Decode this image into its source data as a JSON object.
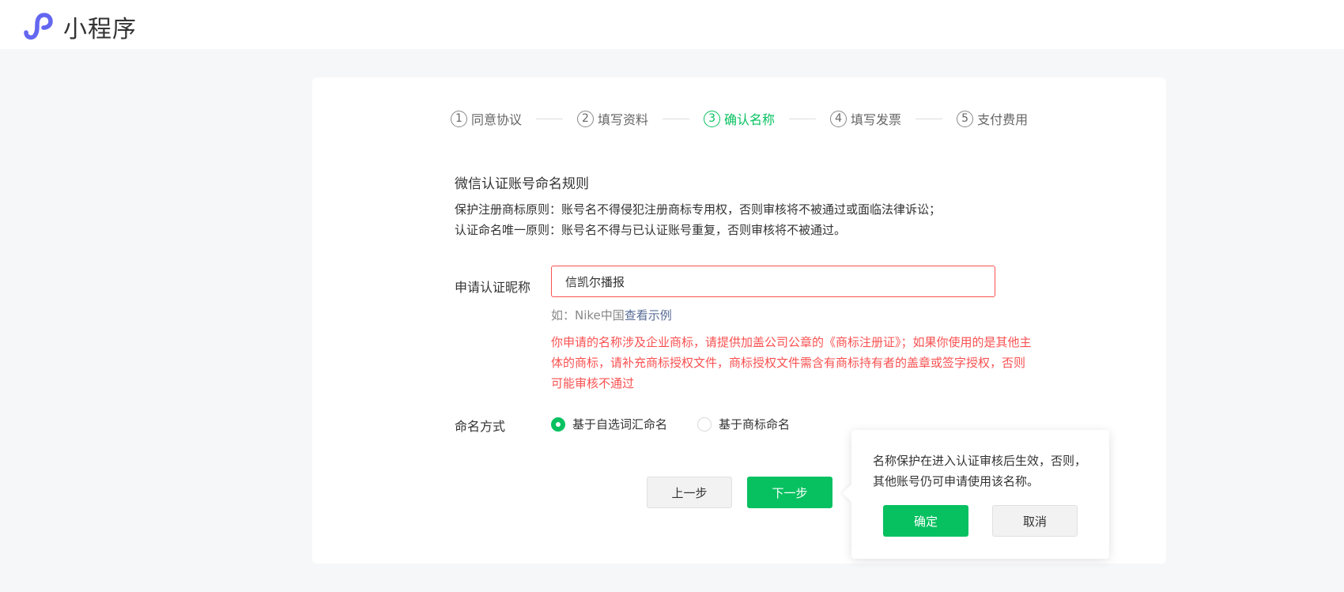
{
  "header": {
    "logo_icon": "miniprogram-logo-icon",
    "brand_text": "小程序",
    "brand_color": "#6467f0"
  },
  "steps": [
    {
      "num": "1",
      "label": "同意协议",
      "active": false
    },
    {
      "num": "2",
      "label": "填写资料",
      "active": false
    },
    {
      "num": "3",
      "label": "确认名称",
      "active": true
    },
    {
      "num": "4",
      "label": "填写发票",
      "active": false
    },
    {
      "num": "5",
      "label": "支付费用",
      "active": false
    }
  ],
  "rules": {
    "title": "微信认证账号命名规则",
    "line1": "保护注册商标原则：账号名不得侵犯注册商标专用权，否则审核将不被通过或面临法律诉讼；",
    "line2": "认证命名唯一原则：账号名不得与已认证账号重复，否则审核将不被通过。"
  },
  "form": {
    "nickname_label": "申请认证昵称",
    "nickname_value": "信凯尔播报",
    "hint_prefix": "如：Nike中国",
    "hint_link": "查看示例",
    "warning": "你申请的名称涉及企业商标，请提供加盖公司公章的《商标注册证》；如果你使用的是其他主体的商标，请补充商标授权文件，商标授权文件需含有商标持有者的盖章或签字授权，否则可能审核不通过",
    "mode_label": "命名方式",
    "mode_options": [
      "基于自选词汇命名",
      "基于商标命名"
    ],
    "mode_selected": "基于自选词汇命名"
  },
  "buttons": {
    "prev": "上一步",
    "next": "下一步"
  },
  "popover": {
    "text": "名称保护在进入认证审核后生效，否则，其他账号仍可申请使用该名称。",
    "ok": "确定",
    "cancel": "取消"
  },
  "colors": {
    "primary": "#07c160",
    "error": "#fa5151",
    "link": "#576b95"
  }
}
